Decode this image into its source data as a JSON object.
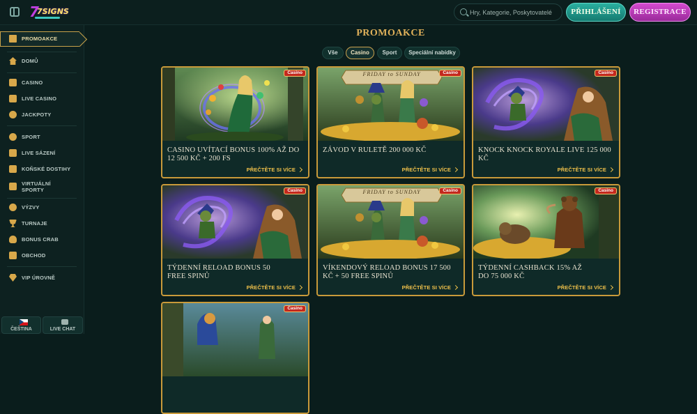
{
  "header": {
    "logo_text": "7SIGNS",
    "search_placeholder": "Hry, Kategorie, Poskytovatelé",
    "login_label": "PŘIHLÁŠENÍ",
    "register_label": "REGISTRACE"
  },
  "sidebar": {
    "items": [
      {
        "label": "PROMOAKCE",
        "icon": "gift-icon"
      },
      {
        "label": "DOMŮ",
        "icon": "home-icon"
      },
      {
        "label": "CASINO",
        "icon": "slot-machine-icon"
      },
      {
        "label": "LIVE CASINO",
        "icon": "live-casino-icon"
      },
      {
        "label": "JACKPOTY",
        "icon": "clover-icon"
      },
      {
        "label": "SPORT",
        "icon": "ball-icon"
      },
      {
        "label": "LIVE SÁZENÍ",
        "icon": "live-betting-icon"
      },
      {
        "label": "KOŇSKÉ DOSTIHY",
        "icon": "horse-icon"
      },
      {
        "label": "VIRTUÁLNÍ SPORTY",
        "icon": "virtual-sports-icon"
      },
      {
        "label": "VÝZVY",
        "icon": "medal-icon"
      },
      {
        "label": "TURNAJE",
        "icon": "trophy-icon"
      },
      {
        "label": "BONUS CRAB",
        "icon": "crab-icon"
      },
      {
        "label": "OBCHOD",
        "icon": "shop-icon"
      },
      {
        "label": "VIP ÚROVNĚ",
        "icon": "diamond-icon"
      }
    ],
    "language_label": "ČEŠTINA",
    "chat_label": "LIVE CHAT"
  },
  "main": {
    "title": "PROMOAKCE",
    "tabs": [
      {
        "label": "Vše",
        "active": false
      },
      {
        "label": "Casino",
        "active": true
      },
      {
        "label": "Sport",
        "active": false
      },
      {
        "label": "Speciální nabídky",
        "active": false
      }
    ],
    "read_more_label": "PŘEČTĚTE SI VÍCE",
    "cards": [
      {
        "badge": "Casino",
        "title": "CASINO UVÍTACÍ BONUS 100% AŽ DO 12 500 KČ + 200 FS",
        "banner": ""
      },
      {
        "badge": "Casino",
        "title": "ZÁVOD V RULETĚ 200 000 KČ",
        "banner": "FRIDAY to SUNDAY"
      },
      {
        "badge": "Casino",
        "title": "KNOCK KNOCK ROYALE LIVE 125 000 KČ",
        "banner": ""
      },
      {
        "badge": "Casino",
        "title": "TÝDENNÍ RELOAD BONUS 50 FREE SPINŮ",
        "banner": ""
      },
      {
        "badge": "Casino",
        "title": "VÍKENDOVÝ RELOAD BONUS 17 500 KČ + 50 FREE SPINŮ",
        "banner": "FRIDAY to SUNDAY"
      },
      {
        "badge": "Casino",
        "title": "TÝDENNÍ CASHBACK 15% AŽ DO 75 000 KČ",
        "banner": ""
      },
      {
        "badge": "Casino",
        "title": "",
        "banner": ""
      }
    ]
  },
  "colors": {
    "gold": "#c99a3a",
    "teal_button": "#1f9a8c",
    "magenta_button": "#c040c0",
    "badge_red": "#c3281e"
  }
}
